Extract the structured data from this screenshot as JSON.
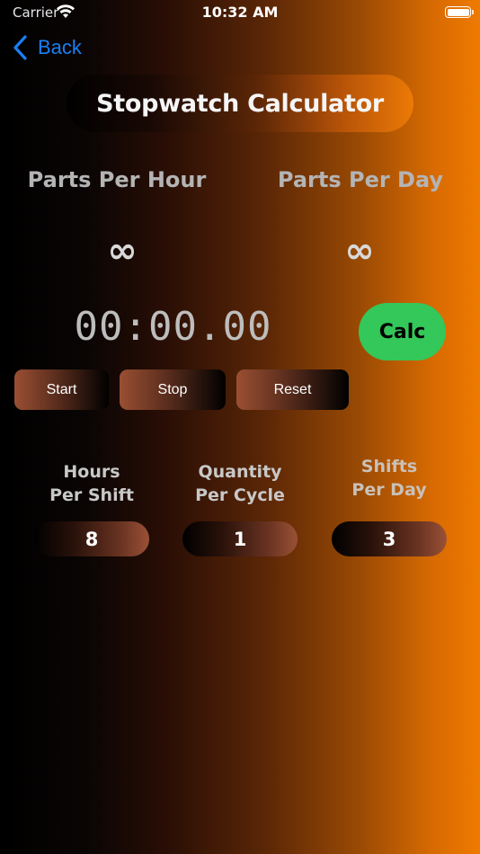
{
  "status_bar": {
    "carrier": "Carrier",
    "time": "10:32 AM"
  },
  "nav": {
    "back_label": "Back"
  },
  "title": "Stopwatch Calculator",
  "rates": {
    "parts_per_hour_label": "Parts Per Hour",
    "parts_per_hour_value": "∞",
    "parts_per_day_label": "Parts Per Day",
    "parts_per_day_value": "∞"
  },
  "timer": {
    "display": "00:00.00"
  },
  "buttons": {
    "calc": "Calc",
    "start": "Start",
    "stop": "Stop",
    "reset": "Reset"
  },
  "params": {
    "hours_label_line1": "Hours",
    "hours_label_line2": "Per Shift",
    "hours_value": "8",
    "quantity_label_line1": "Quantity",
    "quantity_label_line2": "Per Cycle",
    "quantity_value": "1",
    "shifts_label_line1": "Shifts",
    "shifts_label_line2": "Per Day",
    "shifts_value": "3"
  },
  "colors": {
    "accent_blue": "#1a7ff5",
    "calc_green": "#34c759",
    "gradient_orange": "#ef7a00"
  },
  "icons": {
    "back": "chevron-left-icon",
    "wifi": "wifi-icon",
    "battery": "battery-icon"
  }
}
